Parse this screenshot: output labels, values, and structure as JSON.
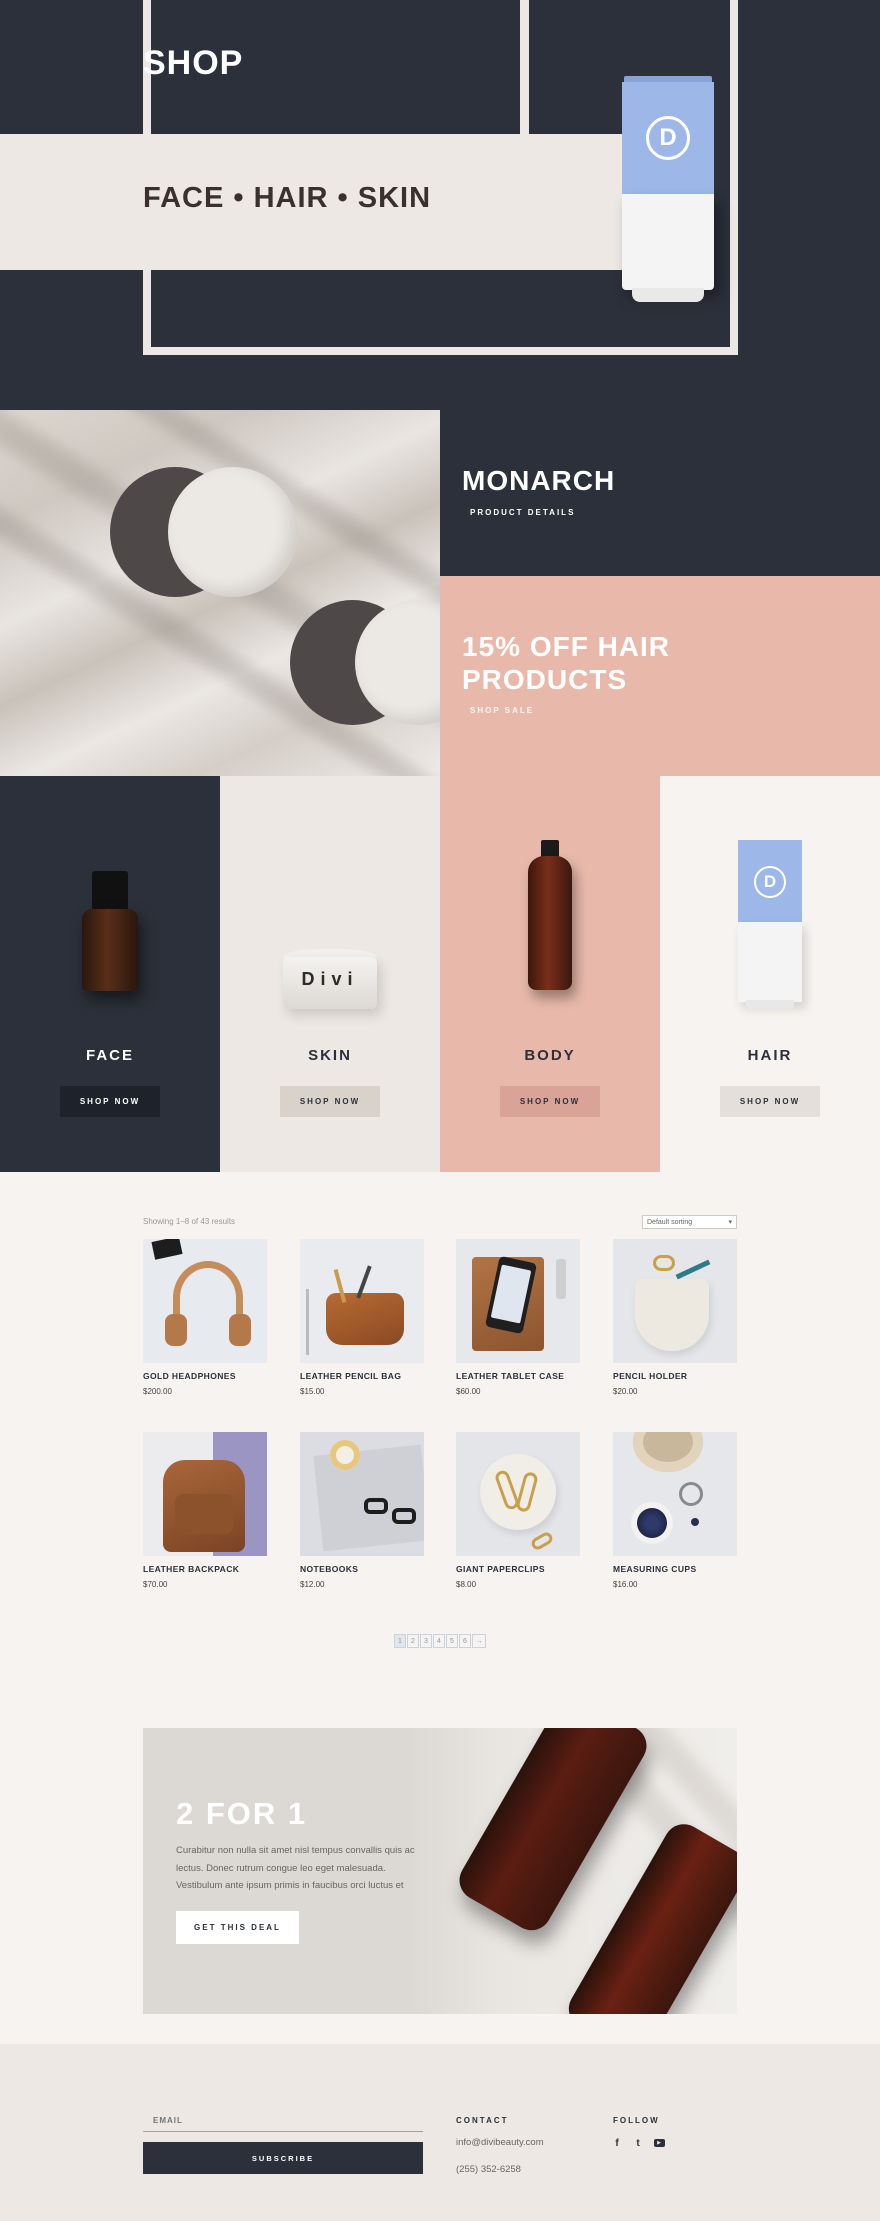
{
  "hero": {
    "title": "SHOP",
    "subtitle": "FACE • HAIR • SKIN",
    "tube_logo": "D"
  },
  "promo": {
    "monarch_title": "MONARCH",
    "monarch_link": "PRODUCT DETAILS",
    "sale_title_line1": "15% OFF HAIR",
    "sale_title_line2": "PRODUCTS",
    "sale_link": "SHOP SALE"
  },
  "categories": [
    {
      "name": "FACE",
      "button": "SHOP NOW"
    },
    {
      "name": "SKIN",
      "button": "SHOP NOW",
      "jar_label": "Divi"
    },
    {
      "name": "BODY",
      "button": "SHOP NOW"
    },
    {
      "name": "HAIR",
      "button": "SHOP NOW",
      "tube_logo": "D"
    }
  ],
  "shop": {
    "results_text": "Showing 1–8 of 43 results",
    "sort_selected": "Default sorting",
    "products": [
      {
        "title": "GOLD HEADPHONES",
        "price": "$200.00"
      },
      {
        "title": "LEATHER PENCIL BAG",
        "price": "$15.00"
      },
      {
        "title": "LEATHER TABLET CASE",
        "price": "$60.00"
      },
      {
        "title": "PENCIL HOLDER",
        "price": "$20.00"
      },
      {
        "title": "LEATHER BACKPACK",
        "price": "$70.00"
      },
      {
        "title": "NOTEBOOKS",
        "price": "$12.00"
      },
      {
        "title": "GIANT PAPERCLIPS",
        "price": "$8.00"
      },
      {
        "title": "MEASURING CUPS",
        "price": "$16.00"
      }
    ],
    "pagination": [
      "1",
      "2",
      "3",
      "4",
      "5",
      "6",
      "→"
    ]
  },
  "deal": {
    "title": "2 FOR 1",
    "body": "Curabitur non nulla sit amet nisl tempus convallis quis ac lectus. Donec rutrum congue leo eget malesuada. Vestibulum ante ipsum primis in faucibus orci luctus et",
    "button": "GET THIS DEAL"
  },
  "footer": {
    "email_placeholder": "EMAIL",
    "subscribe": "SUBSCRIBE",
    "contact_heading": "CONTACT",
    "contact_email": "info@divibeauty.com",
    "contact_phone": "(255) 352-6258",
    "follow_heading": "FOLLOW",
    "social": [
      {
        "icon": "facebook-icon",
        "glyph": "f"
      },
      {
        "icon": "twitter-icon",
        "glyph": "t"
      },
      {
        "icon": "youtube-icon",
        "glyph": "▶"
      }
    ]
  },
  "colors": {
    "dark": "#2b303a",
    "cream": "#ede8e3",
    "pink": "#e8b9ab",
    "tube_blue": "#9db8e8"
  }
}
